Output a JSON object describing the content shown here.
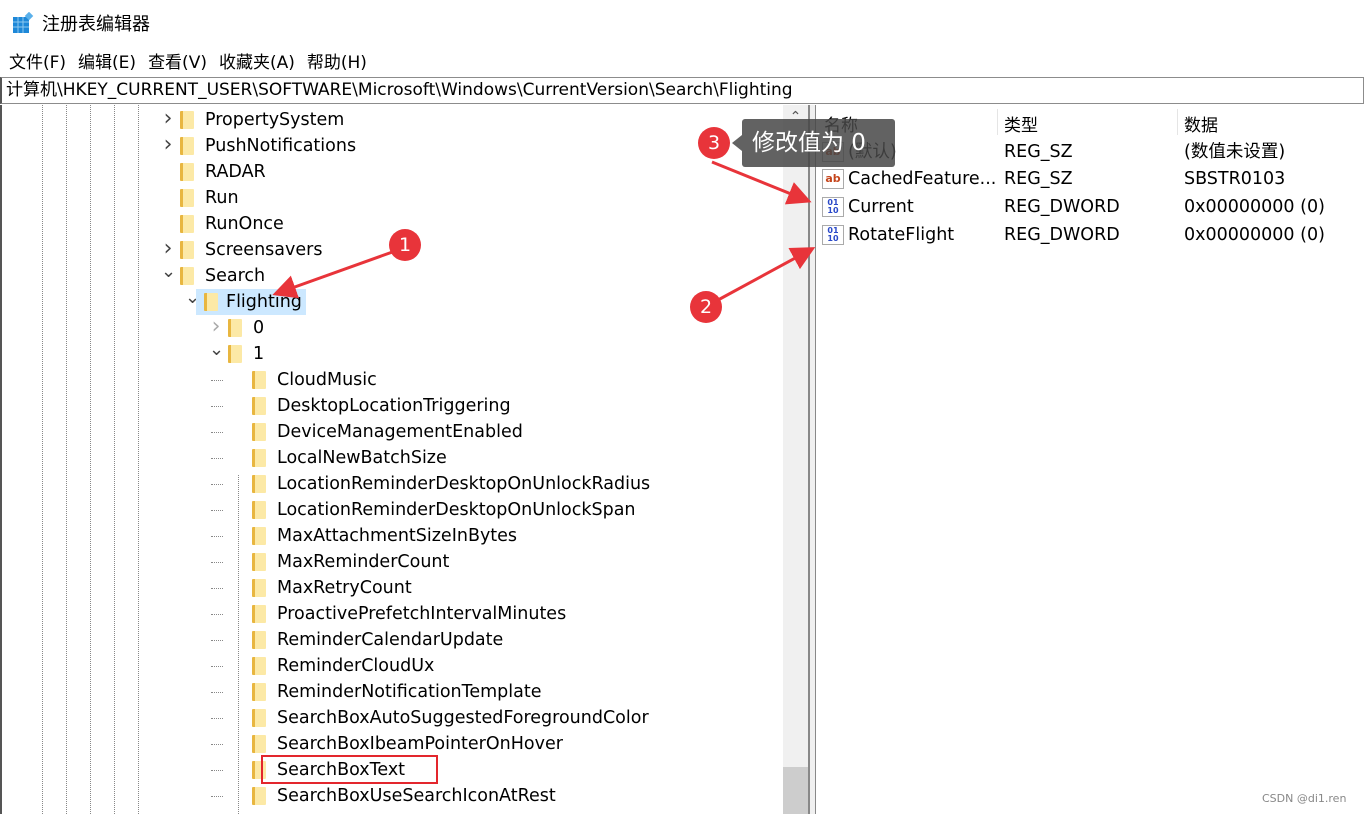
{
  "window": {
    "title": "注册表编辑器",
    "icon": "registry-editor-icon"
  },
  "menu": [
    "文件(F)",
    "编辑(E)",
    "查看(V)",
    "收藏夹(A)",
    "帮助(H)"
  ],
  "address": "计算机\\HKEY_CURRENT_USER\\SOFTWARE\\Microsoft\\Windows\\CurrentVersion\\Search\\Flighting",
  "tree": [
    {
      "name": "PropertySystem",
      "depth": 0,
      "expander": "collapsed"
    },
    {
      "name": "PushNotifications",
      "depth": 0,
      "expander": "collapsed"
    },
    {
      "name": "RADAR",
      "depth": 0,
      "expander": "none"
    },
    {
      "name": "Run",
      "depth": 0,
      "expander": "none"
    },
    {
      "name": "RunOnce",
      "depth": 0,
      "expander": "none"
    },
    {
      "name": "Screensavers",
      "depth": 0,
      "expander": "collapsed"
    },
    {
      "name": "Search",
      "depth": 0,
      "expander": "expanded"
    },
    {
      "name": "Flighting",
      "depth": 1,
      "expander": "expanded",
      "selected": true
    },
    {
      "name": "0",
      "depth": 2,
      "expander": "collapsed"
    },
    {
      "name": "1",
      "depth": 2,
      "expander": "expanded"
    },
    {
      "name": "CloudMusic",
      "depth": 3,
      "expander": "none"
    },
    {
      "name": "DesktopLocationTriggering",
      "depth": 3,
      "expander": "none"
    },
    {
      "name": "DeviceManagementEnabled",
      "depth": 3,
      "expander": "none"
    },
    {
      "name": "LocalNewBatchSize",
      "depth": 3,
      "expander": "none"
    },
    {
      "name": "LocationReminderDesktopOnUnlockRadius",
      "depth": 3,
      "expander": "none"
    },
    {
      "name": "LocationReminderDesktopOnUnlockSpan",
      "depth": 3,
      "expander": "none"
    },
    {
      "name": "MaxAttachmentSizeInBytes",
      "depth": 3,
      "expander": "none"
    },
    {
      "name": "MaxReminderCount",
      "depth": 3,
      "expander": "none"
    },
    {
      "name": "MaxRetryCount",
      "depth": 3,
      "expander": "none"
    },
    {
      "name": "ProactivePrefetchIntervalMinutes",
      "depth": 3,
      "expander": "none"
    },
    {
      "name": "ReminderCalendarUpdate",
      "depth": 3,
      "expander": "none"
    },
    {
      "name": "ReminderCloudUx",
      "depth": 3,
      "expander": "none"
    },
    {
      "name": "ReminderNotificationTemplate",
      "depth": 3,
      "expander": "none"
    },
    {
      "name": "SearchBoxAutoSuggestedForegroundColor",
      "depth": 3,
      "expander": "none"
    },
    {
      "name": "SearchBoxIbeamPointerOnHover",
      "depth": 3,
      "expander": "none"
    },
    {
      "name": "SearchBoxText",
      "depth": 3,
      "expander": "none"
    },
    {
      "name": "SearchBoxUseSearchIconAtRest",
      "depth": 3,
      "expander": "none"
    }
  ],
  "values": {
    "headers": [
      "名称",
      "类型",
      "数据"
    ],
    "rows": [
      {
        "name": "(默认)",
        "type": "REG_SZ",
        "data": "(数值未设置)",
        "icon": "string-value-icon"
      },
      {
        "name": "CachedFeature...",
        "type": "REG_SZ",
        "data": "SBSTR0103",
        "icon": "string-value-icon"
      },
      {
        "name": "Current",
        "type": "REG_DWORD",
        "data": "0x00000000 (0)",
        "icon": "binary-value-icon"
      },
      {
        "name": "RotateFlight",
        "type": "REG_DWORD",
        "data": "0x00000000 (0)",
        "icon": "binary-value-icon"
      }
    ]
  },
  "annotations": {
    "badges": [
      "1",
      "2",
      "3"
    ],
    "tooltip": "修改值为 0",
    "color": "#e8343a"
  },
  "watermark": "CSDN @di1.ren"
}
